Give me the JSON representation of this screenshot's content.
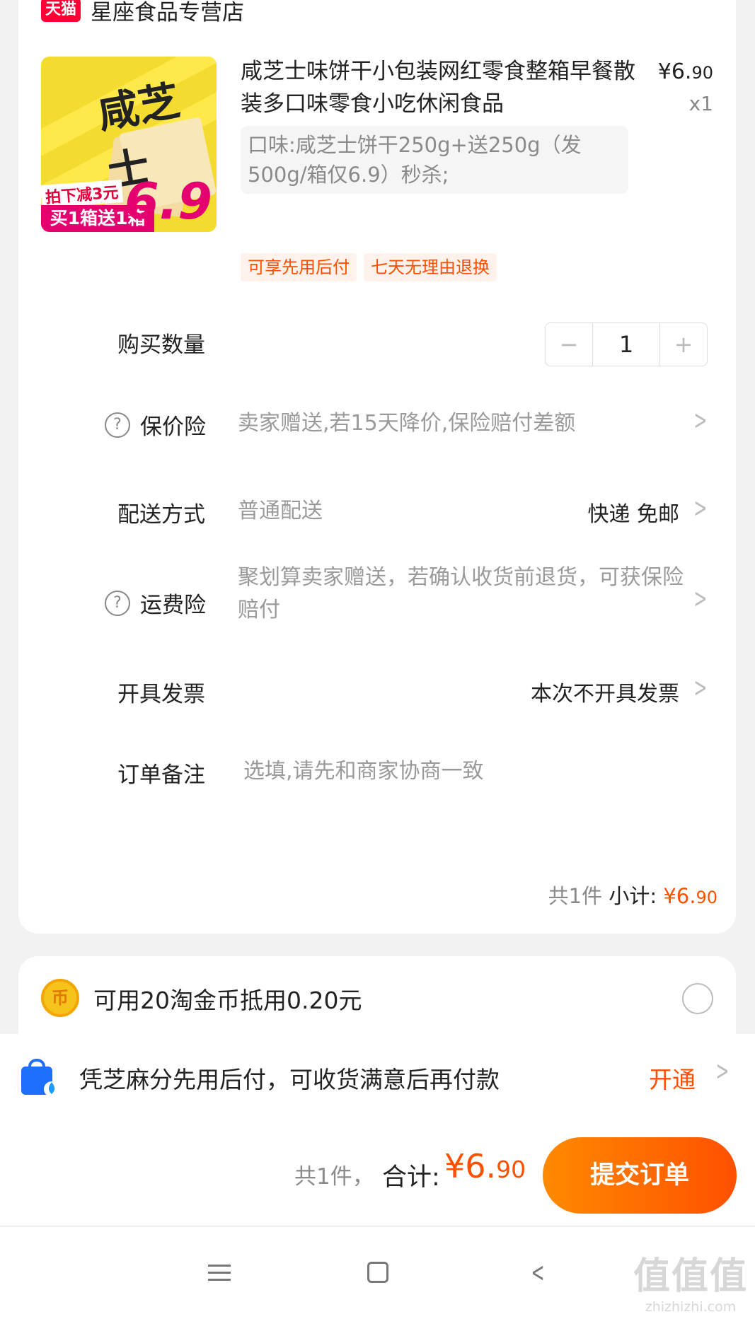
{
  "shop": {
    "badge": "天猫",
    "name": "星座食品专营店"
  },
  "product": {
    "title": "咸芝士味饼干小包装网红零食整箱早餐散装多口味零食小吃休闲食品",
    "price_main": "¥6.",
    "price_decimal": "90",
    "quantity_label": "x1",
    "sku": "口味:咸芝士饼干250g+送250g（发500g/箱仅6.9）秒杀;",
    "image_text": {
      "brand": "咸芝士",
      "promo_top": "拍下减3元",
      "promo_bottom": "买1箱送1箱",
      "price": "6.9"
    },
    "tags": [
      "可享先用后付",
      "七天无理由退换"
    ]
  },
  "quantity": {
    "label": "购买数量",
    "minus": "−",
    "value": "1",
    "plus": "+"
  },
  "price_protect": {
    "icon": "?",
    "label": "保价险",
    "value": "卖家赠送,若15天降价,保险赔付差额"
  },
  "delivery": {
    "label": "配送方式",
    "value": "普通配送",
    "right": "快递 免邮"
  },
  "freight_insurance": {
    "icon": "?",
    "label": "运费险",
    "value": "聚划算卖家赠送，若确认收货前退货，可获保险赔付"
  },
  "invoice": {
    "label": "开具发票",
    "right": "本次不开具发票"
  },
  "remark": {
    "label": "订单备注",
    "placeholder": "选填,请先和商家协商一致"
  },
  "subtotal": {
    "count": "共1件",
    "label": "小计:",
    "amount_main": "¥6.",
    "amount_decimal": "90"
  },
  "coin": {
    "icon": "币",
    "text": "可用20淘金币抵用0.20元"
  },
  "zhima": {
    "text": "凭芝麻分先用后付，可收货满意后再付款",
    "action": "开通"
  },
  "bottom": {
    "count": "共1件，",
    "label": "合计:",
    "amount_main": "¥6.",
    "amount_decimal": "90",
    "submit": "提交订单"
  },
  "watermark": {
    "logo": "值值值",
    "url": "zhizhizhi.com"
  },
  "colors": {
    "accent": "#ff5000",
    "tmall": "#ff0036",
    "background": "#f2f2f2"
  }
}
